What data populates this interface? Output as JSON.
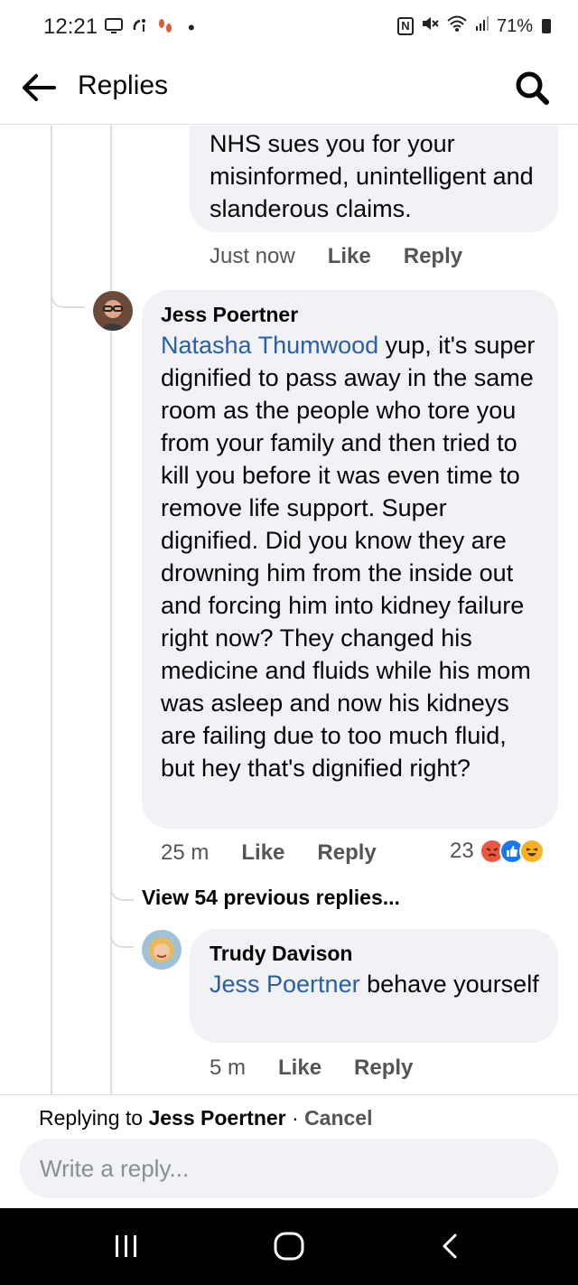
{
  "status_bar": {
    "time": "12:21",
    "battery": "71%",
    "icons": [
      "screen-icon",
      "missed-call-icon",
      "footsteps-icon",
      "dot-icon",
      "nfc-icon",
      "mute-icon",
      "wifi-icon",
      "signal-icon",
      "battery-icon"
    ]
  },
  "header": {
    "title": "Replies",
    "back_icon": "back-arrow-icon",
    "search_icon": "search-icon"
  },
  "comments": [
    {
      "text": "NHS sues you for your misinformed, unintelligent and slanderous claims.",
      "time": "Just now",
      "like": "Like",
      "reply": "Reply"
    },
    {
      "author": "Jess Poertner",
      "mention": "Natasha Thumwood",
      "text": " yup, it's super dignified to pass away in the same room as the people who tore you from your family and then tried to kill you before it was even time to remove life support. Super dignified. Did you know they are drowning him from the inside out and forcing him into kidney failure right now? They changed his medicine and fluids while his mom was asleep and now his kidneys are failing due to too much fluid, but hey that's dignified right?",
      "time": "25 m",
      "like": "Like",
      "reply": "Reply",
      "reaction_count": "23",
      "reactions": [
        "angry",
        "like",
        "haha"
      ]
    },
    {
      "author": "Trudy Davison",
      "mention": "Jess Poertner",
      "text": " behave yourself",
      "time": "5 m",
      "like": "Like",
      "reply": "Reply"
    }
  ],
  "view_previous": "View 54 previous replies...",
  "footer": {
    "replying_prefix": "Replying to ",
    "replying_to": "Jess Poertner",
    "separator": " · ",
    "cancel": "Cancel",
    "placeholder": "Write a reply..."
  },
  "colors": {
    "bubble": "#f0f2f5",
    "mention": "#2a5ea8",
    "angry": "#e9573f",
    "like": "#1877f2",
    "haha": "#f7b125"
  }
}
